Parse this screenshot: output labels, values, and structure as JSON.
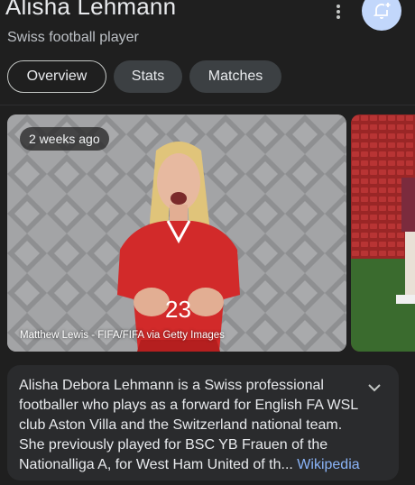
{
  "header": {
    "title": "Alisha Lehmann",
    "subtitle": "Swiss football player",
    "more_icon": "more-vert-icon",
    "follow_icon": "notification-add-icon"
  },
  "tabs": [
    {
      "label": "Overview",
      "active": true
    },
    {
      "label": "Stats",
      "active": false
    },
    {
      "label": "Matches",
      "active": false
    }
  ],
  "images": [
    {
      "badge": "2 weeks ago",
      "credit": "Matthew Lewis - FIFA/FIFA via Getty Images",
      "jersey_number": "23"
    },
    {
      "badge": "",
      "credit": ""
    }
  ],
  "description": {
    "text": "Alisha Debora Lehmann is a Swiss professional footballer who plays as a forward for English FA WSL club Aston Villa and the Switzerland national team. She previously played for BSC YB Frauen of the Nationalliga A, for West Ham United of th... ",
    "source_link": "Wikipedia",
    "expand_icon": "chevron-down-icon"
  },
  "colors": {
    "background": "#1f1f1f",
    "accent_link": "#8ab4f8",
    "follow_button": "#c2d7fb"
  }
}
